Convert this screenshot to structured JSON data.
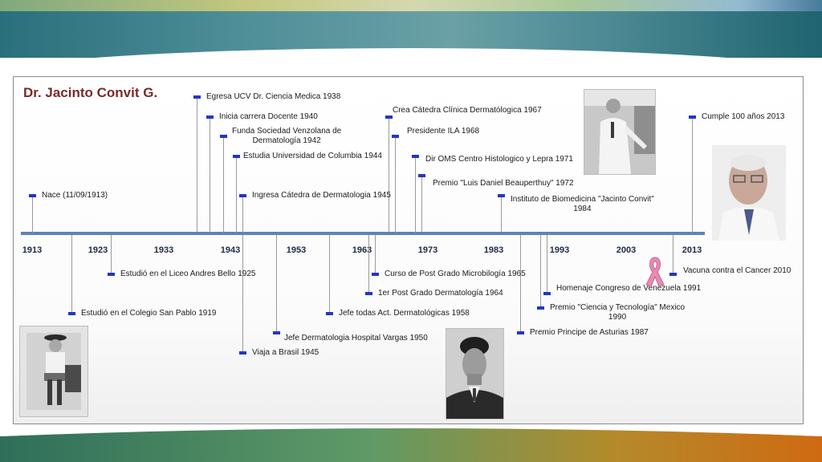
{
  "title": "Dr. Jacinto Convit  G.",
  "colors": {
    "axis": "#5c84b8",
    "marker": "#2236c4",
    "title": "#7a2a2a",
    "ribbon": "#e88bb3"
  },
  "timeline": {
    "ticks": [
      "1913",
      "1923",
      "1933",
      "1943",
      "1953",
      "1963",
      "1973",
      "1983",
      "1993",
      "2003",
      "2013"
    ],
    "events": [
      {
        "label": "Nace (11/09/1913)"
      },
      {
        "label": "Egresa UCV Dr. Ciencia Medica 1938"
      },
      {
        "label": "Inicia carrera Docente 1940"
      },
      {
        "label": "Funda Sociedad Venzolana de\nDermatología 1942"
      },
      {
        "label": "Estudia Universidad de Columbia 1944"
      },
      {
        "label": "Ingresa Cátedra de Dermatologia 1945"
      },
      {
        "label": "Crea Cátedra Clínica Dermatólogica 1967"
      },
      {
        "label": "Presidente ILA 1968"
      },
      {
        "label": "Dir OMS Centro Histologico y Lepra 1971"
      },
      {
        "label": "Premio \"Luis Daniel Beauperthuy\" 1972"
      },
      {
        "label": "Instituto de Biomedicina \"Jacinto Convit\"\n1984"
      },
      {
        "label": "Cumple 100 años 2013"
      },
      {
        "label": "Estudió en el Liceo Andres Bello 1925"
      },
      {
        "label": "Estudió en el Colegio San Pablo 1919"
      },
      {
        "label": "Jefe Dermatologia Hospital Vargas 1950"
      },
      {
        "label": "Viaja  a Brasil 1945"
      },
      {
        "label": "Jefe todas Act. Dermatológicas 1958"
      },
      {
        "label": "Curso de Post Grado Microbilogía 1965"
      },
      {
        "label": "1er Post Grado Dermatología 1964"
      },
      {
        "label": "Premio Principe de Asturias 1987"
      },
      {
        "label": "Homenaje Congreso de Venezuela 1991"
      },
      {
        "label": "Premio \"Ciencia y Tecnología\" Mexico\n1990"
      },
      {
        "label": "Vacuna contra el Cancer 2010"
      }
    ]
  },
  "photos": [
    "child-portrait-photo",
    "young-man-portrait-photo",
    "doctor-lab-photo",
    "elderly-portrait-photo"
  ]
}
